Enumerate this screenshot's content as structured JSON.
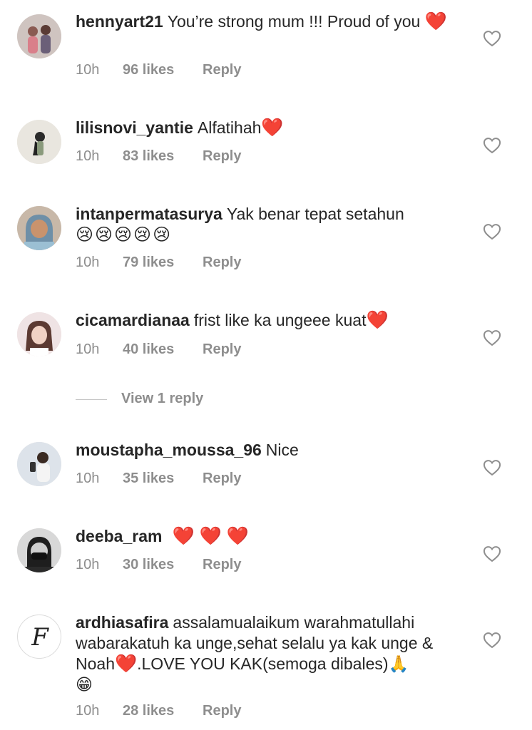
{
  "comments": [
    {
      "username": "hennyart21",
      "text": "You’re strong mum !!! Proud of you",
      "emoji": "❤️",
      "time": "10h",
      "likes": "96 likes",
      "reply": "Reply"
    },
    {
      "username": "lilisnovi_yantie",
      "text": "Alfatihah",
      "emoji": "❤️",
      "time": "10h",
      "likes": "83 likes",
      "reply": "Reply"
    },
    {
      "username": "intanpermatasurya",
      "text": "Yak benar tepat setahun",
      "emoji": "😢😢😢😢😢",
      "time": "10h",
      "likes": "79 likes",
      "reply": "Reply"
    },
    {
      "username": "cicamardianaa",
      "text": "frist like ka ungeee kuat",
      "emoji": "❤️",
      "time": "10h",
      "likes": "40 likes",
      "reply": "Reply"
    },
    {
      "username": "moustapha_moussa_96",
      "text": "Nice",
      "emoji": "",
      "time": "10h",
      "likes": "35 likes",
      "reply": "Reply"
    },
    {
      "username": "deeba_ram",
      "text": "",
      "emoji": "❤️ ❤️ ❤️",
      "time": "10h",
      "likes": "30 likes",
      "reply": "Reply"
    },
    {
      "username": "ardhiasafira",
      "text": "assalamualaikum warahmatullahi wabarakatuh ka unge,sehat selalu ya kak unge & Noah",
      "text2": ".LOVE YOU KAK(semoga dibales)",
      "emoji": "❤️",
      "emoji2": "🙏",
      "emoji3": "😁",
      "time": "10h",
      "likes": "28 likes",
      "reply": "Reply"
    }
  ],
  "view_replies": "View 1 reply",
  "avatar_letter": "F",
  "colors": {
    "heart_red": "#e0182d",
    "meta_gray": "#8e8e8e",
    "text": "#262626"
  }
}
